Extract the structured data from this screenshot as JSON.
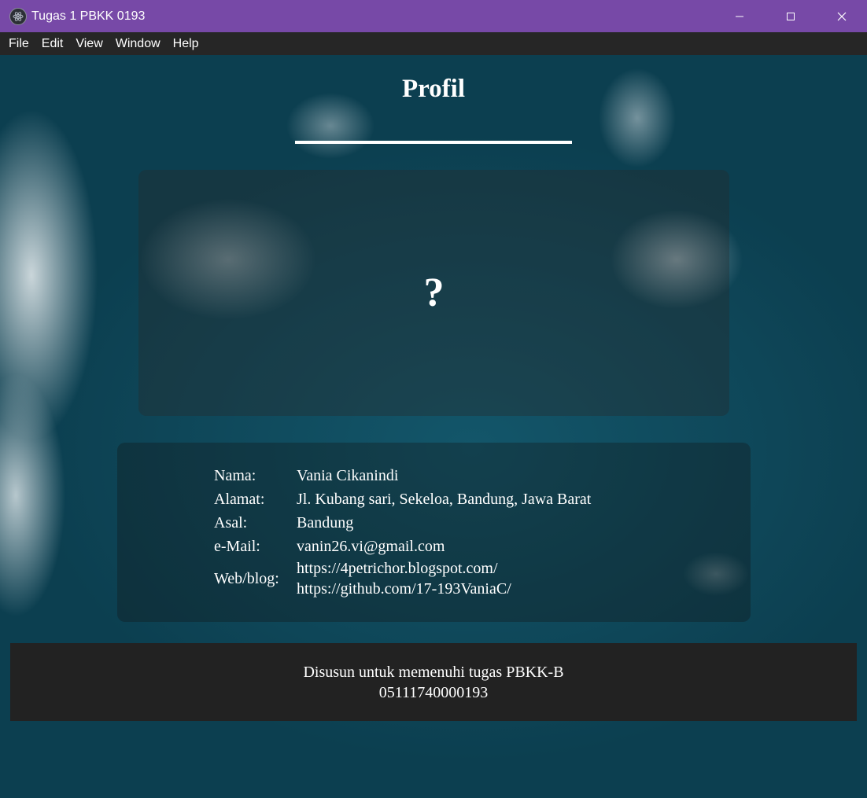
{
  "window": {
    "title": "Tugas 1 PBKK 0193",
    "icon": "electron-app-icon",
    "controls": [
      "minimize-icon",
      "maximize-icon",
      "close-icon"
    ]
  },
  "menu": [
    "File",
    "Edit",
    "View",
    "Window",
    "Help"
  ],
  "page": {
    "heading": "Profil",
    "photo_placeholder": "?",
    "profile": {
      "name_label": "Nama:",
      "name": "Vania Cikanindi",
      "address_label": "Alamat:",
      "address": "Jl. Kubang sari, Sekeloa, Bandung, Jawa Barat",
      "origin_label": "Asal:",
      "origin": "Bandung",
      "email_label": "e-Mail:",
      "email": "vanin26.vi@gmail.com",
      "web_label": "Web/blog:",
      "web_1": "https://4petrichor.blogspot.com/",
      "web_2": "https://github.com/17-193VaniaC/"
    },
    "footer": {
      "line1": "Disusun untuk memenuhi tugas PBKK-B",
      "line2": "05111740000193"
    }
  },
  "colors": {
    "titlebar": "#7749a7",
    "menubar": "#262626",
    "footer": "#222222",
    "text": "#ffffff"
  }
}
